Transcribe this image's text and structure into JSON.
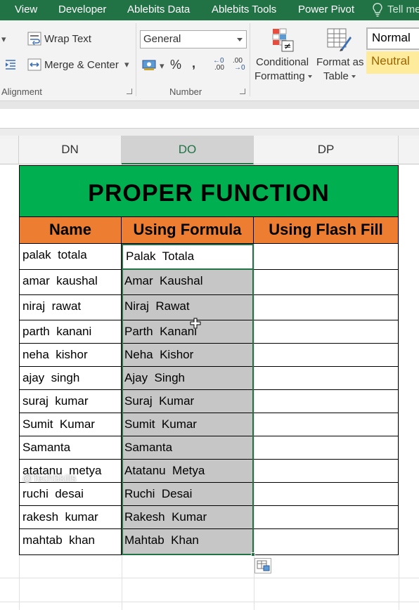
{
  "ribbon_tabs": [
    "View",
    "Developer",
    "Ablebits Data",
    "Ablebits Tools",
    "Power Pivot",
    "Tell me"
  ],
  "alignment": {
    "wrap_text": "Wrap Text",
    "merge_center": "Merge & Center",
    "group_label": "Alignment"
  },
  "number": {
    "format_value": "General",
    "percent_symbol": "%",
    "comma_symbol": ",",
    "inc_decimal": ".00",
    "group_label": "Number"
  },
  "styles": {
    "conditional_formatting_line1": "Conditional",
    "conditional_formatting_line2": "Formatting",
    "format_as_table_line1": "Format as",
    "format_as_table_line2": "Table",
    "normal": "Normal",
    "neutral": "Neutral"
  },
  "columns": [
    "DN",
    "DO",
    "DP"
  ],
  "sheet": {
    "title": "PROPER FUNCTION",
    "headers": [
      "Name",
      "Using Formula",
      "Using Flash Fill"
    ],
    "rows": [
      [
        "palak  totala",
        "Palak  Totala",
        ""
      ],
      [
        "amar  kaushal",
        "Amar  Kaushal",
        ""
      ],
      [
        "niraj  rawat",
        "Niraj  Rawat",
        ""
      ],
      [
        "parth  kanani",
        "Parth  Kanani",
        ""
      ],
      [
        "neha  kishor",
        "Neha  Kishor",
        ""
      ],
      [
        "ajay  singh",
        "Ajay  Singh",
        ""
      ],
      [
        "suraj  kumar",
        "Suraj  Kumar",
        ""
      ],
      [
        "Sumit  Kumar",
        "Sumit  Kumar",
        ""
      ],
      [
        "Samanta",
        "Samanta",
        ""
      ],
      [
        "atatanu  metya",
        "Atatanu  Metya",
        ""
      ],
      [
        "ruchi  desai",
        "Ruchi  Desai",
        ""
      ],
      [
        "rakesh  kumar",
        "Rakesh  Kumar",
        ""
      ],
      [
        "mahtab  khan",
        "Mahtab  Khan",
        ""
      ]
    ]
  },
  "watermark": "@TechSkills",
  "colors": {
    "ribbon_green": "#217346",
    "title_fill": "#00b050",
    "header_fill": "#ed7d31",
    "selection_fill": "#c6c6c6",
    "neutral_fill": "#ffeb9c"
  }
}
